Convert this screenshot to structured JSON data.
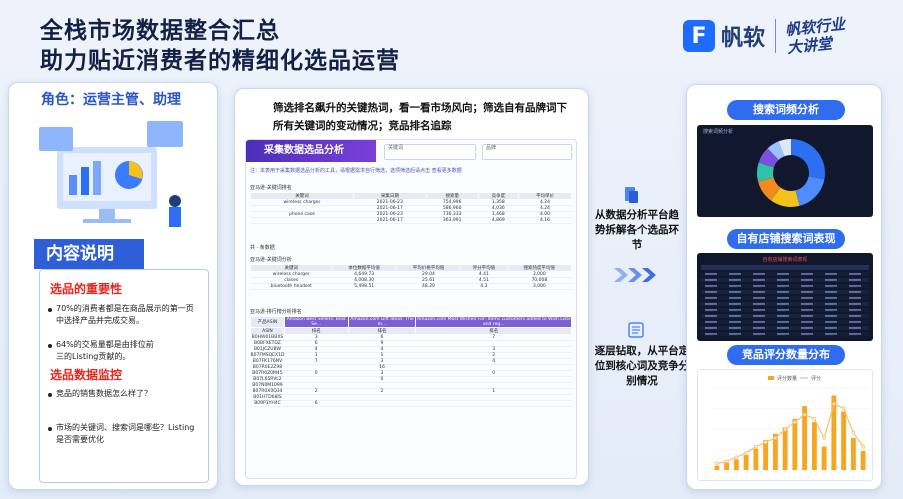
{
  "header": {
    "title_line1": "全栈市场数据整合汇总",
    "title_line2": "助力贴近消费者的精细化选品运营",
    "brand_name": "帆软",
    "brand_tag_line1": "帆软行业",
    "brand_tag_line2": "大讲堂",
    "brand_color": "#1f6bff"
  },
  "left": {
    "role": "角色：运营主管、助理",
    "section_title": "内容说明",
    "heading1": "选品的重要性",
    "item1": "70%的消费者都是在商品展示的第一页中选择产品并完成交易。",
    "item2": "64%的交易量都是由排位前三的Listing贡献的。",
    "heading2": "选品数据监控",
    "item3": "竞品的销售数据怎么样了？",
    "item4": "市场的关键词、搜索词是哪些？Listing是否需要优化"
  },
  "middle": {
    "description": "筛选排名飙升的关键热词，看一看市场风向；筛选自有品牌词下所有关键词的变动情况；竞品排名追踪",
    "report": {
      "banner": "采集数据选品分析",
      "filter1": "关键词",
      "filter2": "品牌",
      "note": "注：本表用于采集数据选品分析的工具，请根据需求自行筛选，选项筛选后请点击  查看更多数据",
      "table1_title": "亚马逊-关键词排名",
      "table1_headers": [
        "关键词",
        "采集日期",
        "搜索量",
        "竞争度",
        "平均单价"
      ],
      "table1_rows": [
        [
          "wireless charger",
          "2021-06-23",
          "754,996",
          "1,358",
          "4.24"
        ],
        [
          "",
          "2021-06-17",
          "586,960",
          "4,036",
          "4.24"
        ],
        [
          "phone case",
          "2021-06-23",
          "736,333",
          "1,468",
          "4.00"
        ],
        [
          "",
          "2021-06-17",
          "363,991",
          "4,869",
          "4.16"
        ]
      ],
      "pager": "共  ·  条数据",
      "table2_title": "亚马逊-关键词分析",
      "table2_headers": [
        "关键词",
        "本位数据平均值",
        "平均价格平均值",
        "评分平均值",
        "搜索热度平均值"
      ],
      "table2_rows": [
        [
          "wireless charger",
          "4,649.73",
          "29.04",
          "4.41",
          "3,000"
        ],
        [
          "clases",
          "4,008.30",
          "25.61",
          "4.51",
          "70,008"
        ],
        [
          "bluetooth headset",
          "5,498.51",
          "48.29",
          "4.3",
          "3,000"
        ]
      ],
      "table3_title": "亚马逊-排行榜分析排名",
      "table3_headers": [
        "产品ASIN",
        "Amazon Best Sellers: Best Se...",
        "Amazon.com Gift Ideas: The m...",
        "Amazon.com Most Wished For: Items customers added to Wish Lists and reg..."
      ],
      "table3_sub": [
        "ASIN",
        "排名",
        "排名",
        "排名"
      ],
      "table3_rows": [
        [
          "B0HW01BBXS",
          "3",
          "6",
          "7"
        ],
        [
          "B0BFXETDZ",
          "6",
          "9",
          ""
        ],
        [
          "B01JCZUBW",
          "4",
          "4",
          "3"
        ],
        [
          "B07FMSQEX1D",
          "1",
          "1",
          "2"
        ],
        [
          "B07FK176NV",
          "7",
          "3",
          "4"
        ],
        [
          "B07R0E2Z98",
          "",
          "16",
          ""
        ],
        [
          "B07R0Z0M45",
          "0",
          "3",
          "0"
        ],
        [
          "B07L65RVL2",
          "",
          "0",
          ""
        ],
        [
          "B07N0M1099",
          "",
          "",
          ""
        ],
        [
          "B07R0X0Q34",
          "2",
          "2",
          "1"
        ],
        [
          "B01HTD68IS",
          "",
          "",
          ""
        ],
        [
          "B09P1YH4C",
          "6",
          "",
          ""
        ]
      ]
    }
  },
  "arrows": {
    "upper_text": "从数据分析平台趋势拆解各个选品环节",
    "lower_text": "逐层钻取，从平台定位到核心词及竞争分别情况"
  },
  "right": {
    "pill1": "搜索词频分析",
    "pill2": "自有店铺搜索词表现",
    "pill3": "竞品评分数量分布",
    "dark1_title": "搜索词频分析",
    "dark2_title": "自有店铺搜索词表现",
    "donut_slices": [
      28,
      18,
      14,
      11,
      9,
      8,
      6,
      6
    ],
    "donut_colors": [
      "#2c6ff0",
      "#4e8cff",
      "#f3c21b",
      "#f08a1c",
      "#2fc2a8",
      "#7b4fe0",
      "#9cc3ff",
      "#e0e6f5"
    ]
  },
  "chart_data": {
    "type": "bar",
    "title": "竞品评分数量分布",
    "values": [
      4,
      7,
      10,
      14,
      20,
      28,
      34,
      40,
      48,
      60,
      45,
      22,
      70,
      55,
      30,
      18
    ],
    "line_values": [
      6,
      8,
      12,
      16,
      22,
      26,
      30,
      38,
      45,
      52,
      48,
      30,
      62,
      58,
      35,
      22
    ],
    "legend": [
      "评分数量",
      "评分"
    ],
    "bar_color": "#f5a623",
    "line_color": "#f5c26a"
  }
}
